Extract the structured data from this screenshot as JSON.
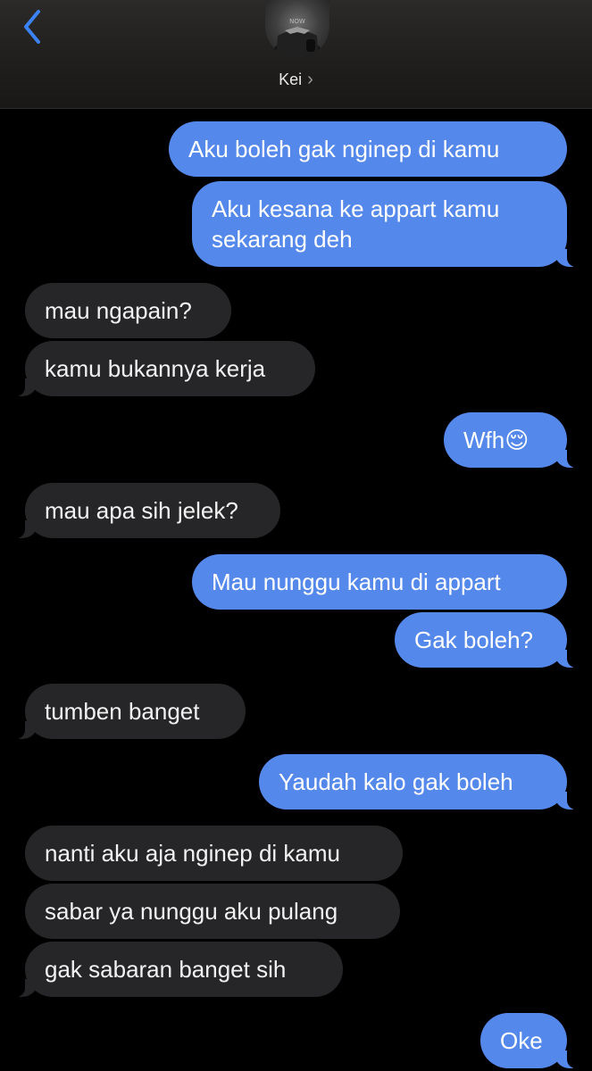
{
  "header": {
    "back_label": "Back",
    "contact_name": "Kei",
    "chevron": "›"
  },
  "colors": {
    "outgoing_bubble": "#5588eb",
    "incoming_bubble": "#262628",
    "accent": "#3b82f6",
    "background": "#000000"
  },
  "messages": [
    {
      "direction": "outgoing",
      "text": "Aku boleh gak nginep di kamu"
    },
    {
      "direction": "outgoing",
      "text": "Aku kesana ke appart kamu sekarang deh"
    },
    {
      "direction": "incoming",
      "text": "mau ngapain?"
    },
    {
      "direction": "incoming",
      "text": "kamu bukannya kerja"
    },
    {
      "direction": "outgoing",
      "text": "Wfh😌"
    },
    {
      "direction": "incoming",
      "text": "mau apa sih jelek?"
    },
    {
      "direction": "outgoing",
      "text": "Mau nunggu kamu di appart"
    },
    {
      "direction": "outgoing",
      "text": "Gak boleh?"
    },
    {
      "direction": "incoming",
      "text": "tumben banget"
    },
    {
      "direction": "outgoing",
      "text": "Yaudah kalo gak boleh"
    },
    {
      "direction": "incoming",
      "text": "nanti aku aja nginep di kamu"
    },
    {
      "direction": "incoming",
      "text": "sabar ya nunggu aku pulang"
    },
    {
      "direction": "incoming",
      "text": "gak sabaran banget sih"
    },
    {
      "direction": "outgoing",
      "text": "Oke"
    }
  ]
}
